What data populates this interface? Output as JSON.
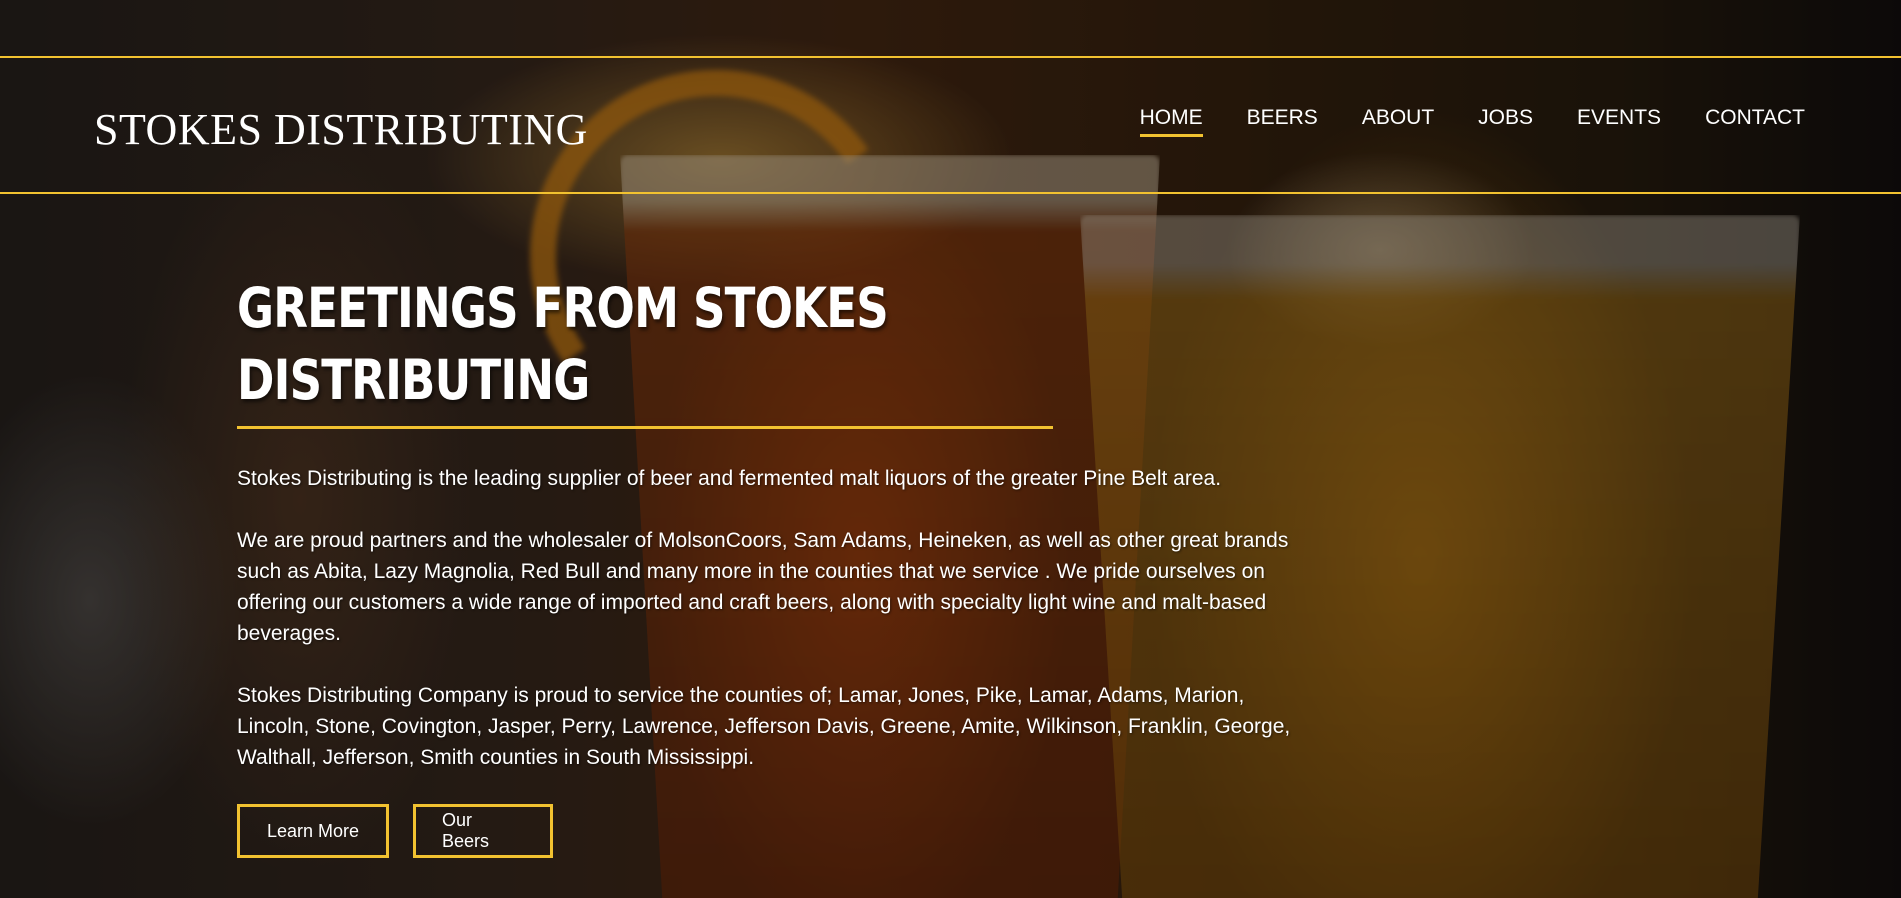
{
  "site": {
    "logo": "STOKES DISTRIBUTING"
  },
  "nav": {
    "items": [
      {
        "label": "HOME",
        "active": true
      },
      {
        "label": "BEERS",
        "active": false
      },
      {
        "label": "ABOUT",
        "active": false
      },
      {
        "label": "JOBS",
        "active": false
      },
      {
        "label": "EVENTS",
        "active": false
      },
      {
        "label": "CONTACT",
        "active": false
      }
    ]
  },
  "hero": {
    "headline": "GREETINGS FROM STOKES DISTRIBUTING",
    "paragraphs": [
      "Stokes Distributing is the leading supplier of beer and fermented malt liquors of the greater Pine Belt area.",
      "We are proud partners and the wholesaler of MolsonCoors, Sam Adams, Heineken, as well as other great brands such as Abita, Lazy Magnolia, Red Bull and many more in the counties that we service . We pride ourselves on offering our customers a wide range of imported and craft beers, along with specialty light wine and malt-based beverages.",
      "Stokes Distributing Company is proud to service the counties of; Lamar, Jones, Pike, Lamar, Adams, Marion, Lincoln, Stone, Covington, Jasper, Perry, Lawrence, Jefferson Davis, Greene, Amite, Wilkinson, Franklin, George, Walthall, Jefferson, Smith counties in South Mississippi."
    ],
    "buttons": {
      "learn_more": "Learn More",
      "our_beers": "Our Beers"
    }
  },
  "colors": {
    "accent": "#f2c230",
    "text": "#ffffff"
  }
}
